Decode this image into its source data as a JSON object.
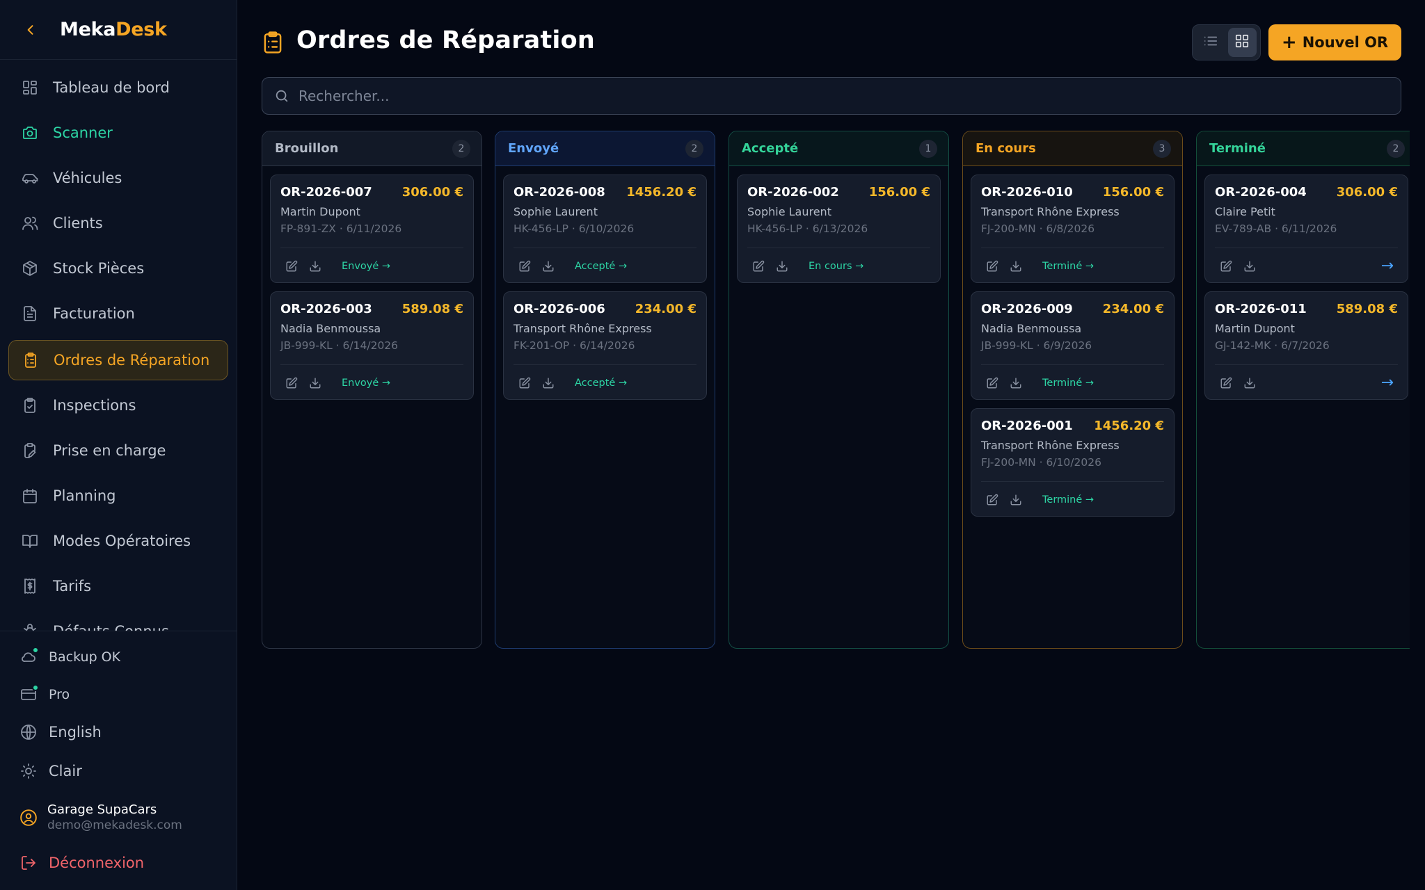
{
  "app": {
    "brand_a": "Meka",
    "brand_b": "Desk"
  },
  "sidebar": {
    "items": [
      {
        "label": "Tableau de bord",
        "icon": "dashboard-icon"
      },
      {
        "label": "Scanner",
        "icon": "camera-icon"
      },
      {
        "label": "Véhicules",
        "icon": "car-icon"
      },
      {
        "label": "Clients",
        "icon": "users-icon"
      },
      {
        "label": "Stock Pièces",
        "icon": "package-icon"
      },
      {
        "label": "Facturation",
        "icon": "file-text-icon"
      },
      {
        "label": "Ordres de Réparation",
        "icon": "clipboard-list-icon"
      },
      {
        "label": "Inspections",
        "icon": "clipboard-check-icon"
      },
      {
        "label": "Prise en charge",
        "icon": "clipboard-pen-icon"
      },
      {
        "label": "Planning",
        "icon": "calendar-icon"
      },
      {
        "label": "Modes Opératoires",
        "icon": "book-open-icon"
      },
      {
        "label": "Tarifs",
        "icon": "receipt-dollar-icon"
      },
      {
        "label": "Défauts Connus",
        "icon": "bug-icon"
      }
    ],
    "footer": {
      "backup": "Backup OK",
      "plan": "Pro",
      "language": "English",
      "theme": "Clair",
      "user_name": "Garage SupaCars",
      "user_email": "demo@mekadesk.com",
      "logout": "Déconnexion"
    }
  },
  "header": {
    "title": "Ordres de Réparation",
    "new_button": "Nouvel OR"
  },
  "search": {
    "placeholder": "Rechercher..."
  },
  "colors": {
    "accent": "#f5a524",
    "success": "#2dd4a4",
    "info": "#4aa3ff",
    "danger": "#f0646a"
  },
  "board": {
    "columns": [
      {
        "title": "Brouillon",
        "count": "2",
        "cards": [
          {
            "id": "OR-2026-007",
            "amount": "306.00 €",
            "client": "Martin Dupont",
            "meta": "FP-891-ZX · 6/11/2026",
            "next": "Envoyé →"
          },
          {
            "id": "OR-2026-003",
            "amount": "589.08 €",
            "client": "Nadia Benmoussa",
            "meta": "JB-999-KL · 6/14/2026",
            "next": "Envoyé →"
          }
        ]
      },
      {
        "title": "Envoyé",
        "count": "2",
        "cards": [
          {
            "id": "OR-2026-008",
            "amount": "1456.20 €",
            "client": "Sophie Laurent",
            "meta": "HK-456-LP · 6/10/2026",
            "next": "Accepté →"
          },
          {
            "id": "OR-2026-006",
            "amount": "234.00 €",
            "client": "Transport Rhône Express",
            "meta": "FK-201-OP · 6/14/2026",
            "next": "Accepté →"
          }
        ]
      },
      {
        "title": "Accepté",
        "count": "1",
        "cards": [
          {
            "id": "OR-2026-002",
            "amount": "156.00 €",
            "client": "Sophie Laurent",
            "meta": "HK-456-LP · 6/13/2026",
            "next": "En cours →"
          }
        ]
      },
      {
        "title": "En cours",
        "count": "3",
        "cards": [
          {
            "id": "OR-2026-010",
            "amount": "156.00 €",
            "client": "Transport Rhône Express",
            "meta": "FJ-200-MN · 6/8/2026",
            "next": "Terminé →"
          },
          {
            "id": "OR-2026-009",
            "amount": "234.00 €",
            "client": "Nadia Benmoussa",
            "meta": "JB-999-KL · 6/9/2026",
            "next": "Terminé →"
          },
          {
            "id": "OR-2026-001",
            "amount": "1456.20 €",
            "client": "Transport Rhône Express",
            "meta": "FJ-200-MN · 6/10/2026",
            "next": "Terminé →"
          }
        ]
      },
      {
        "title": "Terminé",
        "count": "2",
        "cards": [
          {
            "id": "OR-2026-004",
            "amount": "306.00 €",
            "client": "Claire Petit",
            "meta": "EV-789-AB · 6/11/2026",
            "next": "→"
          },
          {
            "id": "OR-2026-011",
            "amount": "589.08 €",
            "client": "Martin Dupont",
            "meta": "GJ-142-MK · 6/7/2026",
            "next": "→"
          }
        ]
      }
    ]
  }
}
